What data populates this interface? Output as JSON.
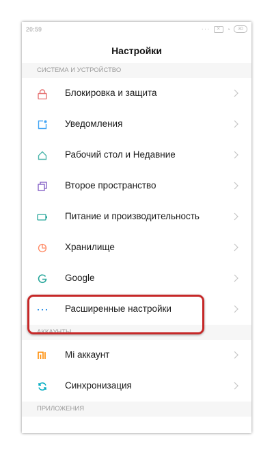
{
  "status": {
    "time": "20:59",
    "battery": "30"
  },
  "page": {
    "title": "Настройки"
  },
  "sections": {
    "system": "СИСТЕМА И УСТРОЙСТВО",
    "accounts": "АККАУНТЫ",
    "apps": "ПРИЛОЖЕНИЯ"
  },
  "items": {
    "lock": "Блокировка и защита",
    "notifications": "Уведомления",
    "desktop": "Рабочий стол и Недавние",
    "second_space": "Второе пространство",
    "power": "Питание и производительность",
    "storage": "Хранилище",
    "google": "Google",
    "advanced": "Расширенные настройки",
    "mi_account": "Mi аккаунт",
    "sync": "Синхронизация"
  },
  "icons": {
    "lock": "lock-icon",
    "notifications": "notification-icon",
    "desktop": "home-icon",
    "second_space": "copy-icon",
    "power": "battery-icon",
    "storage": "pie-icon",
    "google": "google-icon",
    "advanced": "more-icon",
    "mi_account": "mi-icon",
    "sync": "sync-icon"
  },
  "colors": {
    "lock": "#e57373",
    "notifications": "#42a5f5",
    "desktop": "#4db6ac",
    "second_space": "#7e57c2",
    "power": "#26a69a",
    "storage": "#ff8a65",
    "google": "#26a69a",
    "advanced": "#1e88e5",
    "mi_account": "#ff8a00",
    "sync": "#00acc1",
    "highlight": "#c62828"
  }
}
